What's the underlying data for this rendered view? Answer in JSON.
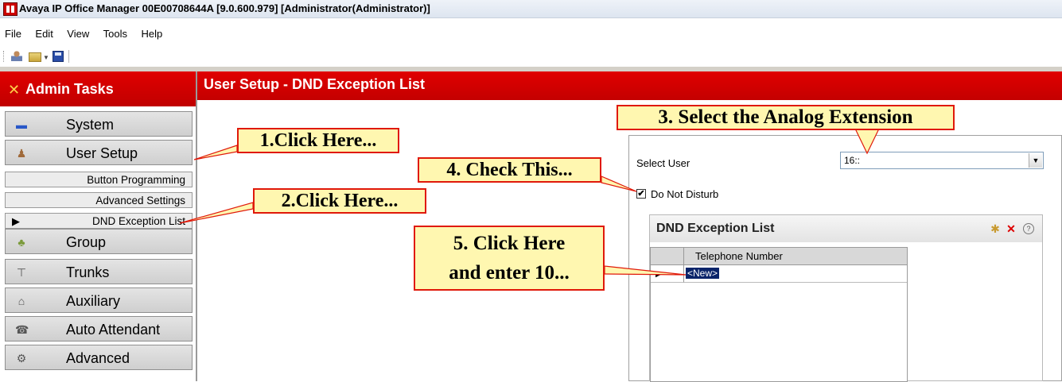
{
  "window": {
    "title": "Avaya IP Office Manager 00E00708644A [9.0.600.979] [Administrator(Administrator)]"
  },
  "menu": [
    "File",
    "Edit",
    "View",
    "Tools",
    "Help"
  ],
  "toolbar": {
    "icons": [
      "user-icon",
      "open-folder-icon",
      "save-icon"
    ]
  },
  "sidebar": {
    "header": "Admin Tasks",
    "items": [
      {
        "label": "System",
        "icon": "system-icon"
      },
      {
        "label": "User Setup",
        "icon": "user-icon"
      },
      {
        "label": "Group",
        "icon": "group-icon"
      },
      {
        "label": "Trunks",
        "icon": "trunks-icon"
      },
      {
        "label": "Auxiliary",
        "icon": "auxiliary-icon"
      },
      {
        "label": "Auto Attendant",
        "icon": "auto-attendant-icon"
      },
      {
        "label": "Advanced",
        "icon": "advanced-icon"
      }
    ],
    "subitems": [
      "Button Programming",
      "Advanced Settings",
      "DND Exception List"
    ]
  },
  "page": {
    "title": "User Setup - DND Exception List",
    "select_user_label": "Select User",
    "select_user_value": "16::",
    "dnd_label": "Do Not Disturb",
    "dnd_checked": true,
    "panel_title": "DND Exception List",
    "column_header": "Telephone Number",
    "row_value": "<New>"
  },
  "callouts": {
    "c1": "1.Click Here...",
    "c2": "2.Click Here...",
    "c3": "3. Select the Analog Extension",
    "c4": "4. Check This...",
    "c5_line1": "5. Click Here",
    "c5_line2": "and enter 10..."
  },
  "colors": {
    "brand_red": "#cc0000",
    "callout_fill": "#fff7b0",
    "callout_border": "#e0190a"
  }
}
